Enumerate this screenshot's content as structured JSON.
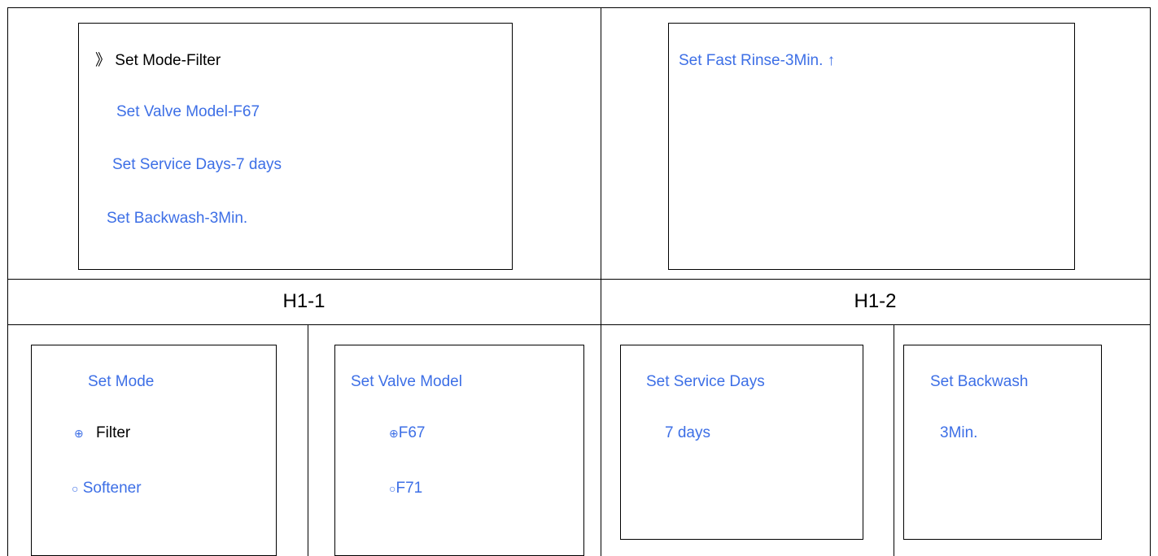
{
  "h1_1": {
    "items": [
      {
        "marker": "》",
        "label": "Set Mode-Filter"
      },
      {
        "label": "Set Valve Model-F67"
      },
      {
        "label": "Set Service Days-7 days"
      },
      {
        "label": "Set Backwash-3Min."
      }
    ],
    "caption": "H1-1"
  },
  "h1_2": {
    "item": "Set Fast Rinse-3Min. ↑",
    "caption": "H1-2"
  },
  "mode": {
    "title": "Set Mode",
    "selected_marker": "⊕",
    "selected": "Filter",
    "unselected_marker": "○",
    "unselected": "Softener"
  },
  "valve": {
    "title": "Set Valve Model",
    "selected_marker": "⊕",
    "selected": "F67",
    "unselected_marker": "○",
    "unselected": "F71"
  },
  "service": {
    "title": "Set Service Days",
    "value": "7 days"
  },
  "backwash": {
    "title": "Set Backwash",
    "value": "3Min."
  },
  "colors": {
    "text_blue": "#3d6fe6",
    "text_black": "#000000",
    "border": "#000000"
  }
}
